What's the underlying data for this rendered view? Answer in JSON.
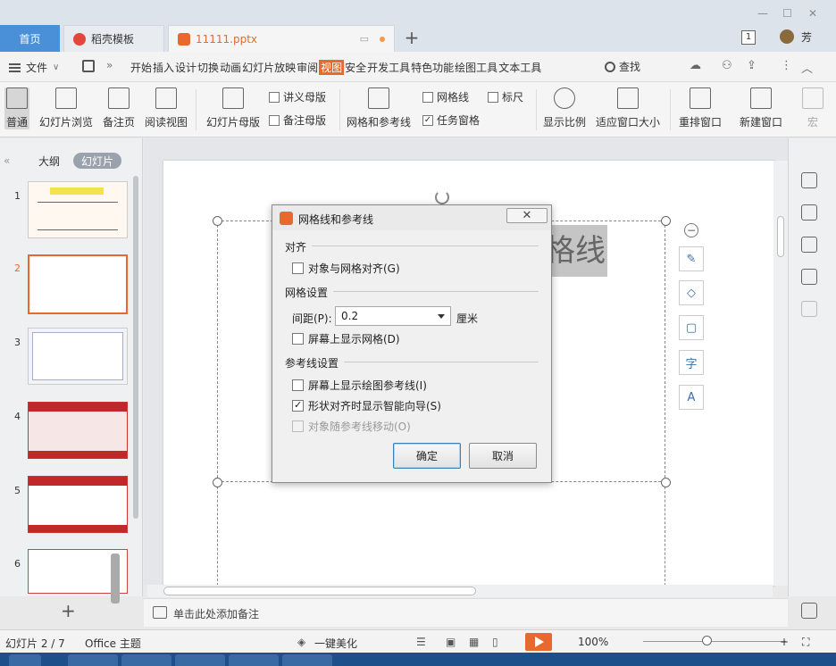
{
  "titlebar": {
    "home_tab": "首页",
    "templates_tab": "稻壳模板",
    "file_tab": "11111.pptx",
    "new_tab": "+",
    "count_badge": "1",
    "user_name": "芳"
  },
  "menubar": {
    "file_label": "文件",
    "items": [
      "开始",
      "插入",
      "设计",
      "切换",
      "动画",
      "幻灯片放映",
      "审阅",
      "视图",
      "安全",
      "开发工具",
      "特色功能",
      "绘图工具",
      "文本工具"
    ],
    "active_item": "视图",
    "find_label": "查找"
  },
  "ribbon": {
    "normal": "普通",
    "slide_sorter": "幻灯片浏览",
    "notes_page": "备注页",
    "reading_view": "阅读视图",
    "slide_master": "幻灯片母版",
    "handout_master": "讲义母版",
    "notes_master": "备注母版",
    "grid_guides": "网格和参考线",
    "gridlines": "网格线",
    "ruler": "标尺",
    "task_pane": "任务窗格",
    "zoom": "显示比例",
    "fit_window": "适应窗口大小",
    "arrange_windows": "重排窗口",
    "new_window": "新建窗口",
    "macro": "宏"
  },
  "pane": {
    "outline_tab": "大纲",
    "slides_tab": "幻灯片",
    "slide_numbers": [
      "1",
      "2",
      "3",
      "4",
      "5",
      "6"
    ],
    "active_slide": "2"
  },
  "slide": {
    "title_text": "格线"
  },
  "notes": {
    "placeholder": "单击此处添加备注"
  },
  "statusbar": {
    "slide_counter": "幻灯片 2 / 7",
    "theme": "Office 主题",
    "beautify": "一键美化",
    "zoom_level": "100%"
  },
  "dialog": {
    "title": "网格线和参考线",
    "close_label": "✕",
    "align_section": "对齐",
    "snap_to_grid": "对象与网格对齐(G)",
    "snap_to_grid_checked": false,
    "grid_section": "网格设置",
    "spacing_label": "间距(P):",
    "spacing_value": "0.2",
    "spacing_unit": "厘米",
    "show_grid": "屏幕上显示网格(D)",
    "show_grid_checked": false,
    "guides_section": "参考线设置",
    "show_drawing_guides": "屏幕上显示绘图参考线(I)",
    "show_drawing_guides_checked": false,
    "smart_guides": "形状对齐时显示智能向导(S)",
    "smart_guides_checked": true,
    "move_with_guides": "对象随参考线移动(O)",
    "move_with_guides_checked": false,
    "ok_label": "确定",
    "cancel_label": "取消"
  }
}
